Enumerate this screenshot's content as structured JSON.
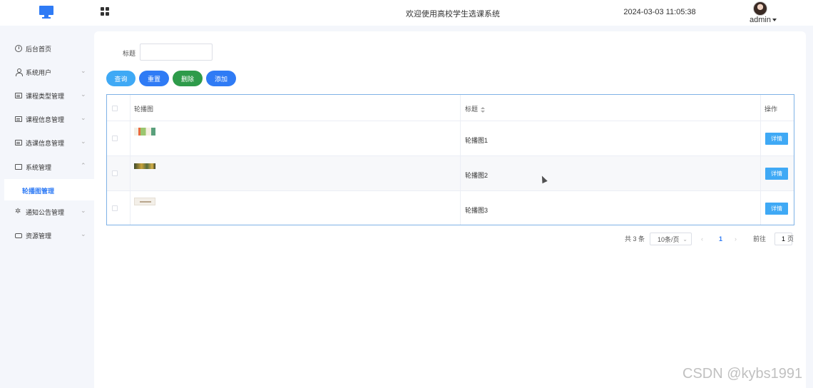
{
  "header": {
    "system_title": "欢迎使用高校学生选课系统",
    "datetime": "2024-03-03 11:05:38",
    "username": "admin",
    "logo_icon": "monitor-icon",
    "menu_toggle_icon": "grid-icon",
    "accent_color": "#2f7bf5"
  },
  "sidebar": {
    "items": [
      {
        "label": "后台首页",
        "icon": "clock-icon"
      },
      {
        "label": "系统用户",
        "icon": "user-icon"
      },
      {
        "label": "课程类型管理",
        "icon": "box-icon"
      },
      {
        "label": "课程信息管理",
        "icon": "box-icon"
      },
      {
        "label": "选课信息管理",
        "icon": "box-icon"
      },
      {
        "label": "系统管理",
        "icon": "folder-icon"
      },
      {
        "label": "通知公告管理",
        "icon": "spark-icon"
      },
      {
        "label": "资源管理",
        "icon": "printer-icon"
      }
    ],
    "active_submenu": "轮播图管理"
  },
  "search": {
    "label": "标题",
    "value": "",
    "placeholder": ""
  },
  "toolbar": {
    "query": "查询",
    "reset": "重置",
    "delete": "删除",
    "add": "添加"
  },
  "table": {
    "columns": [
      "轮播图",
      "标题",
      "操作"
    ],
    "rows": [
      {
        "title": "轮播图1",
        "action": "详情"
      },
      {
        "title": "轮播图2",
        "action": "详情"
      },
      {
        "title": "轮播图3",
        "action": "详情"
      }
    ]
  },
  "pagination": {
    "total": "共 3 条",
    "page_size": "10条/页",
    "current_page": "1",
    "goto_prefix": "前往",
    "goto_value": "1",
    "goto_suffix": "页"
  },
  "watermark": "CSDN @kybs1991"
}
